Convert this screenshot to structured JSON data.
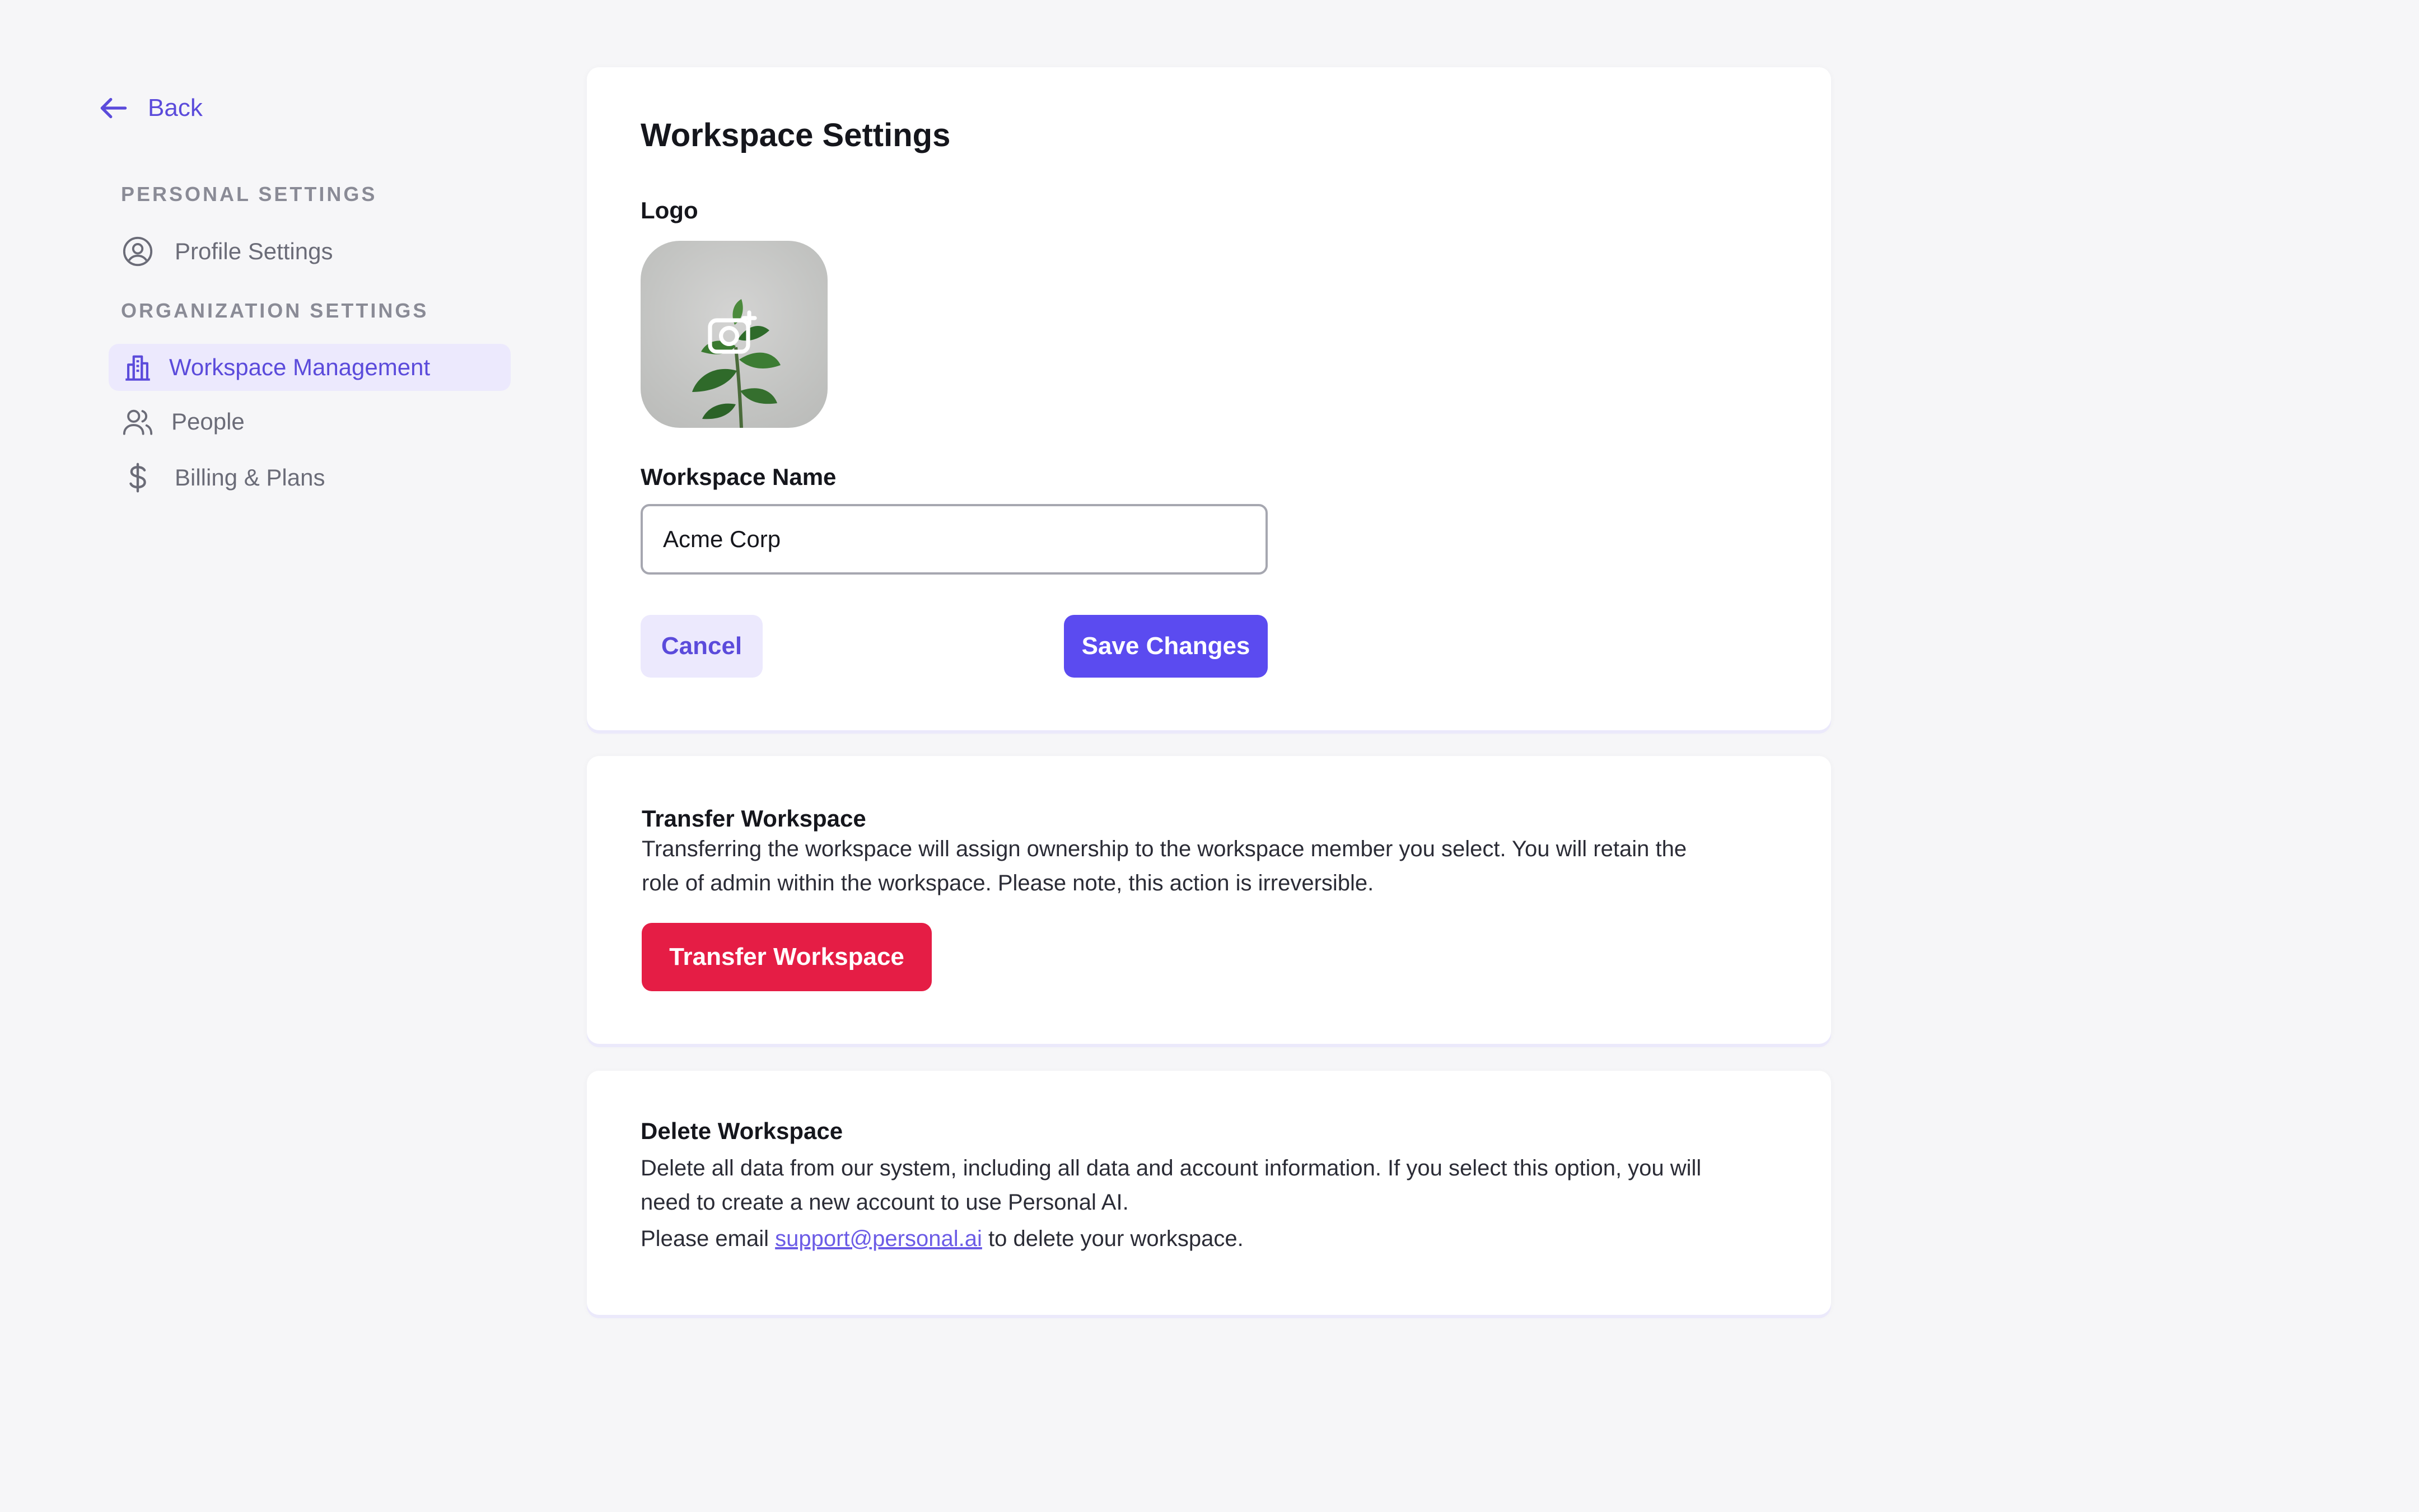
{
  "sidebar": {
    "back_label": "Back",
    "personal_section": "PERSONAL SETTINGS",
    "org_section": "ORGANIZATION SETTINGS",
    "items": [
      {
        "label": "Profile Settings",
        "icon": "user-circle-icon"
      },
      {
        "label": "Workspace Management",
        "icon": "building-icon",
        "active": true
      },
      {
        "label": "People",
        "icon": "users-icon"
      },
      {
        "label": "Billing & Plans",
        "icon": "dollar-icon"
      }
    ]
  },
  "workspace_settings": {
    "title": "Workspace Settings",
    "logo_label": "Logo",
    "name_label": "Workspace Name",
    "name_value": "Acme Corp",
    "cancel_label": "Cancel",
    "save_label": "Save Changes"
  },
  "transfer": {
    "title": "Transfer Workspace",
    "description_line1": "Transferring the workspace will assign ownership to the workspace member you select. You will retain the",
    "description_line2": "role of admin within the workspace. Please note, this action is irreversible.",
    "button_label": "Transfer Workspace"
  },
  "delete": {
    "title": "Delete Workspace",
    "description_line1": "Delete all data from our system, including all data and account information. If you select this option, you will",
    "description_line2": "need to create a new account to use Personal AI.",
    "email_prefix": "Please email",
    "email": "support@personal.ai",
    "email_suffix": "to delete your workspace."
  },
  "colors": {
    "accent": "#5b4bdb",
    "primary_button": "#5b4bf0",
    "danger": "#e51d45",
    "background": "#f6f6f8"
  }
}
